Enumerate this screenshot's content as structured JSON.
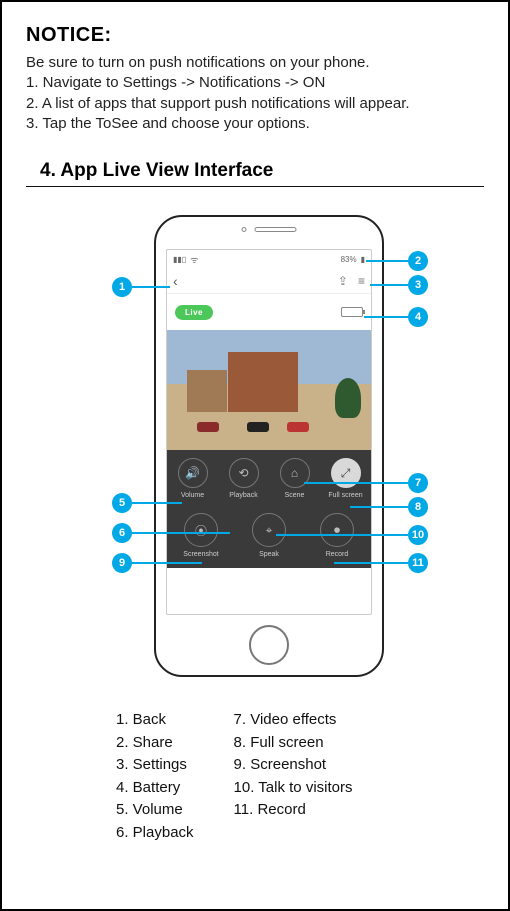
{
  "notice": {
    "title": "NOTICE:",
    "intro": "Be sure to turn on push notifications on your phone.",
    "steps": [
      "1. Navigate to Settings -> Notifications -> ON",
      "2. A list of apps that support push notifications will appear.",
      "3. Tap the ToSee and choose your options."
    ]
  },
  "section4": {
    "title": "4. App Live View Interface"
  },
  "phone": {
    "status": {
      "battery_text": "83%"
    },
    "back_glyph": "‹",
    "share_glyph": "⇪",
    "settings_glyph": "≡",
    "live_label": "Live",
    "controls_row1": [
      {
        "icon": "🔊",
        "label": "Volume"
      },
      {
        "icon": "⟲",
        "label": "Playback"
      },
      {
        "icon": "⌂",
        "label": "Scene"
      },
      {
        "icon": "⤢",
        "label": "Full screen",
        "light": true
      }
    ],
    "controls_row2": [
      {
        "icon": "⦿",
        "label": "Screenshot"
      },
      {
        "icon": "⌖",
        "label": "Speak"
      },
      {
        "icon": "⏺",
        "label": "Record"
      }
    ]
  },
  "callouts": {
    "1": "1",
    "2": "2",
    "3": "3",
    "4": "4",
    "5": "5",
    "6": "6",
    "7": "7",
    "8": "8",
    "9": "9",
    "10": "10",
    "11": "11"
  },
  "legend": {
    "col1": [
      "1. Back",
      "2. Share",
      "3. Settings",
      "4. Battery",
      "5. Volume",
      "6. Playback"
    ],
    "col2": [
      "7. Video effects",
      "8. Full screen",
      "9. Screenshot",
      "10. Talk to visitors",
      "11. Record"
    ]
  }
}
